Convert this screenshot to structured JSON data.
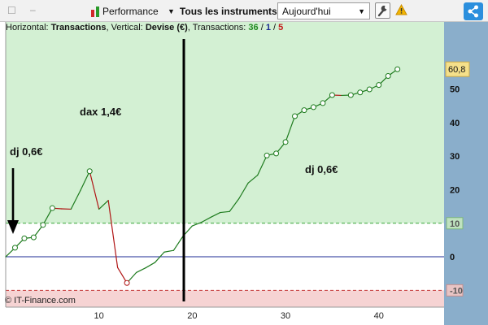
{
  "toolbar": {
    "performance_label": "Performance",
    "instruments_label": "Tous les instruments",
    "period_value": "Aujourd'hui",
    "icons": [
      "square-icon",
      "minimize-icon",
      "candlestick-icon",
      "chevron-down-icon",
      "wrench-icon",
      "warning-icon",
      "share-icon"
    ]
  },
  "header": {
    "horizontal_label": "Horizontal:",
    "horizontal_value": "Transactions",
    "vertical_label": ", Vertical:",
    "vertical_value": "Devise (€)",
    "transactions_label": ", Transactions:",
    "count_green": "36",
    "sep1": "/",
    "count_blue": "1",
    "sep2": "/",
    "count_red": "5"
  },
  "annotations": [
    {
      "text": "dax 1,4€"
    },
    {
      "text": "dj 0,6€"
    },
    {
      "text": "dj 0,6€"
    }
  ],
  "copyright": "© IT-Finance.com",
  "colors": {
    "positive_zone": "#d3f0d3",
    "negative_zone": "#f6d3d3",
    "up_segment": "#1e7b1e",
    "down_segment": "#b01414",
    "zero_line": "#1c2b94",
    "axis_background": "#8aaecb",
    "last_value_badge": "#f5e08a"
  },
  "chart_data": {
    "type": "line",
    "xlim": [
      0,
      47
    ],
    "ylim": [
      -15,
      70
    ],
    "x_ticks": [
      10,
      20,
      30,
      40
    ],
    "y_ticks": [
      -10,
      0,
      10,
      20,
      30,
      40,
      50
    ],
    "y_tick_labels": [
      "-10",
      "0",
      "10",
      "20",
      "30",
      "40",
      "50"
    ],
    "last_value_label": "60,8",
    "thresholds": [
      10,
      -10
    ],
    "x": [
      0,
      1,
      2,
      3,
      4,
      5,
      6,
      7,
      8,
      9,
      10,
      11,
      12,
      13,
      14,
      15,
      16,
      17,
      18,
      19,
      20,
      21,
      22,
      23,
      24,
      25,
      26,
      27,
      28,
      29,
      30,
      31,
      32,
      33,
      34,
      35,
      36,
      37,
      38,
      39,
      40,
      41,
      42
    ],
    "y": [
      0,
      2.7,
      5.5,
      5.8,
      9.5,
      14.5,
      14.3,
      14.2,
      19.7,
      25.5,
      14.2,
      16.8,
      -3.2,
      -7.8,
      -4.7,
      -3.3,
      -1.7,
      1.4,
      1.9,
      6.1,
      9.2,
      10.3,
      11.8,
      13.2,
      13.5,
      17.3,
      22,
      24.3,
      30.2,
      30.8,
      34.2,
      41.9,
      43.7,
      44.6,
      45.8,
      48.2,
      48.1,
      48.2,
      49,
      49.9,
      51.2,
      53.9,
      55.9
    ],
    "markers": [
      1,
      2,
      3,
      4,
      5,
      9,
      13,
      28,
      29,
      30,
      31,
      32,
      33,
      34,
      35,
      37,
      38,
      39,
      40,
      41,
      42
    ]
  }
}
